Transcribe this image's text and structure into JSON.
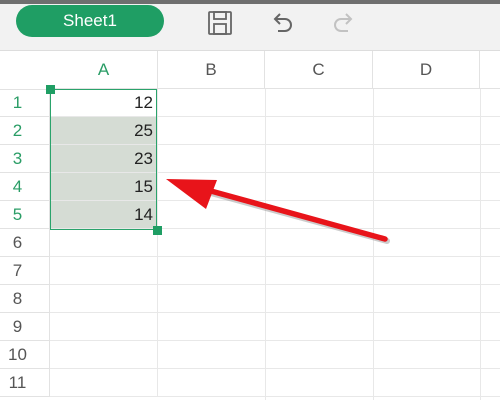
{
  "toolbar": {
    "sheet_tab_label": "Sheet1",
    "icons": [
      "save-icon",
      "undo-icon",
      "redo-icon"
    ]
  },
  "grid": {
    "columns": [
      "A",
      "B",
      "C",
      "D"
    ],
    "rows": [
      "1",
      "2",
      "3",
      "4",
      "5",
      "6",
      "7",
      "8",
      "9",
      "10",
      "11"
    ],
    "column_a_values": [
      "12",
      "25",
      "23",
      "15",
      "14",
      "",
      "",
      "",
      "",
      "",
      ""
    ]
  },
  "colors": {
    "accent": "#1f9e64",
    "selection_fill": "#d5dcd4",
    "annotation_arrow": "#e8141a"
  }
}
